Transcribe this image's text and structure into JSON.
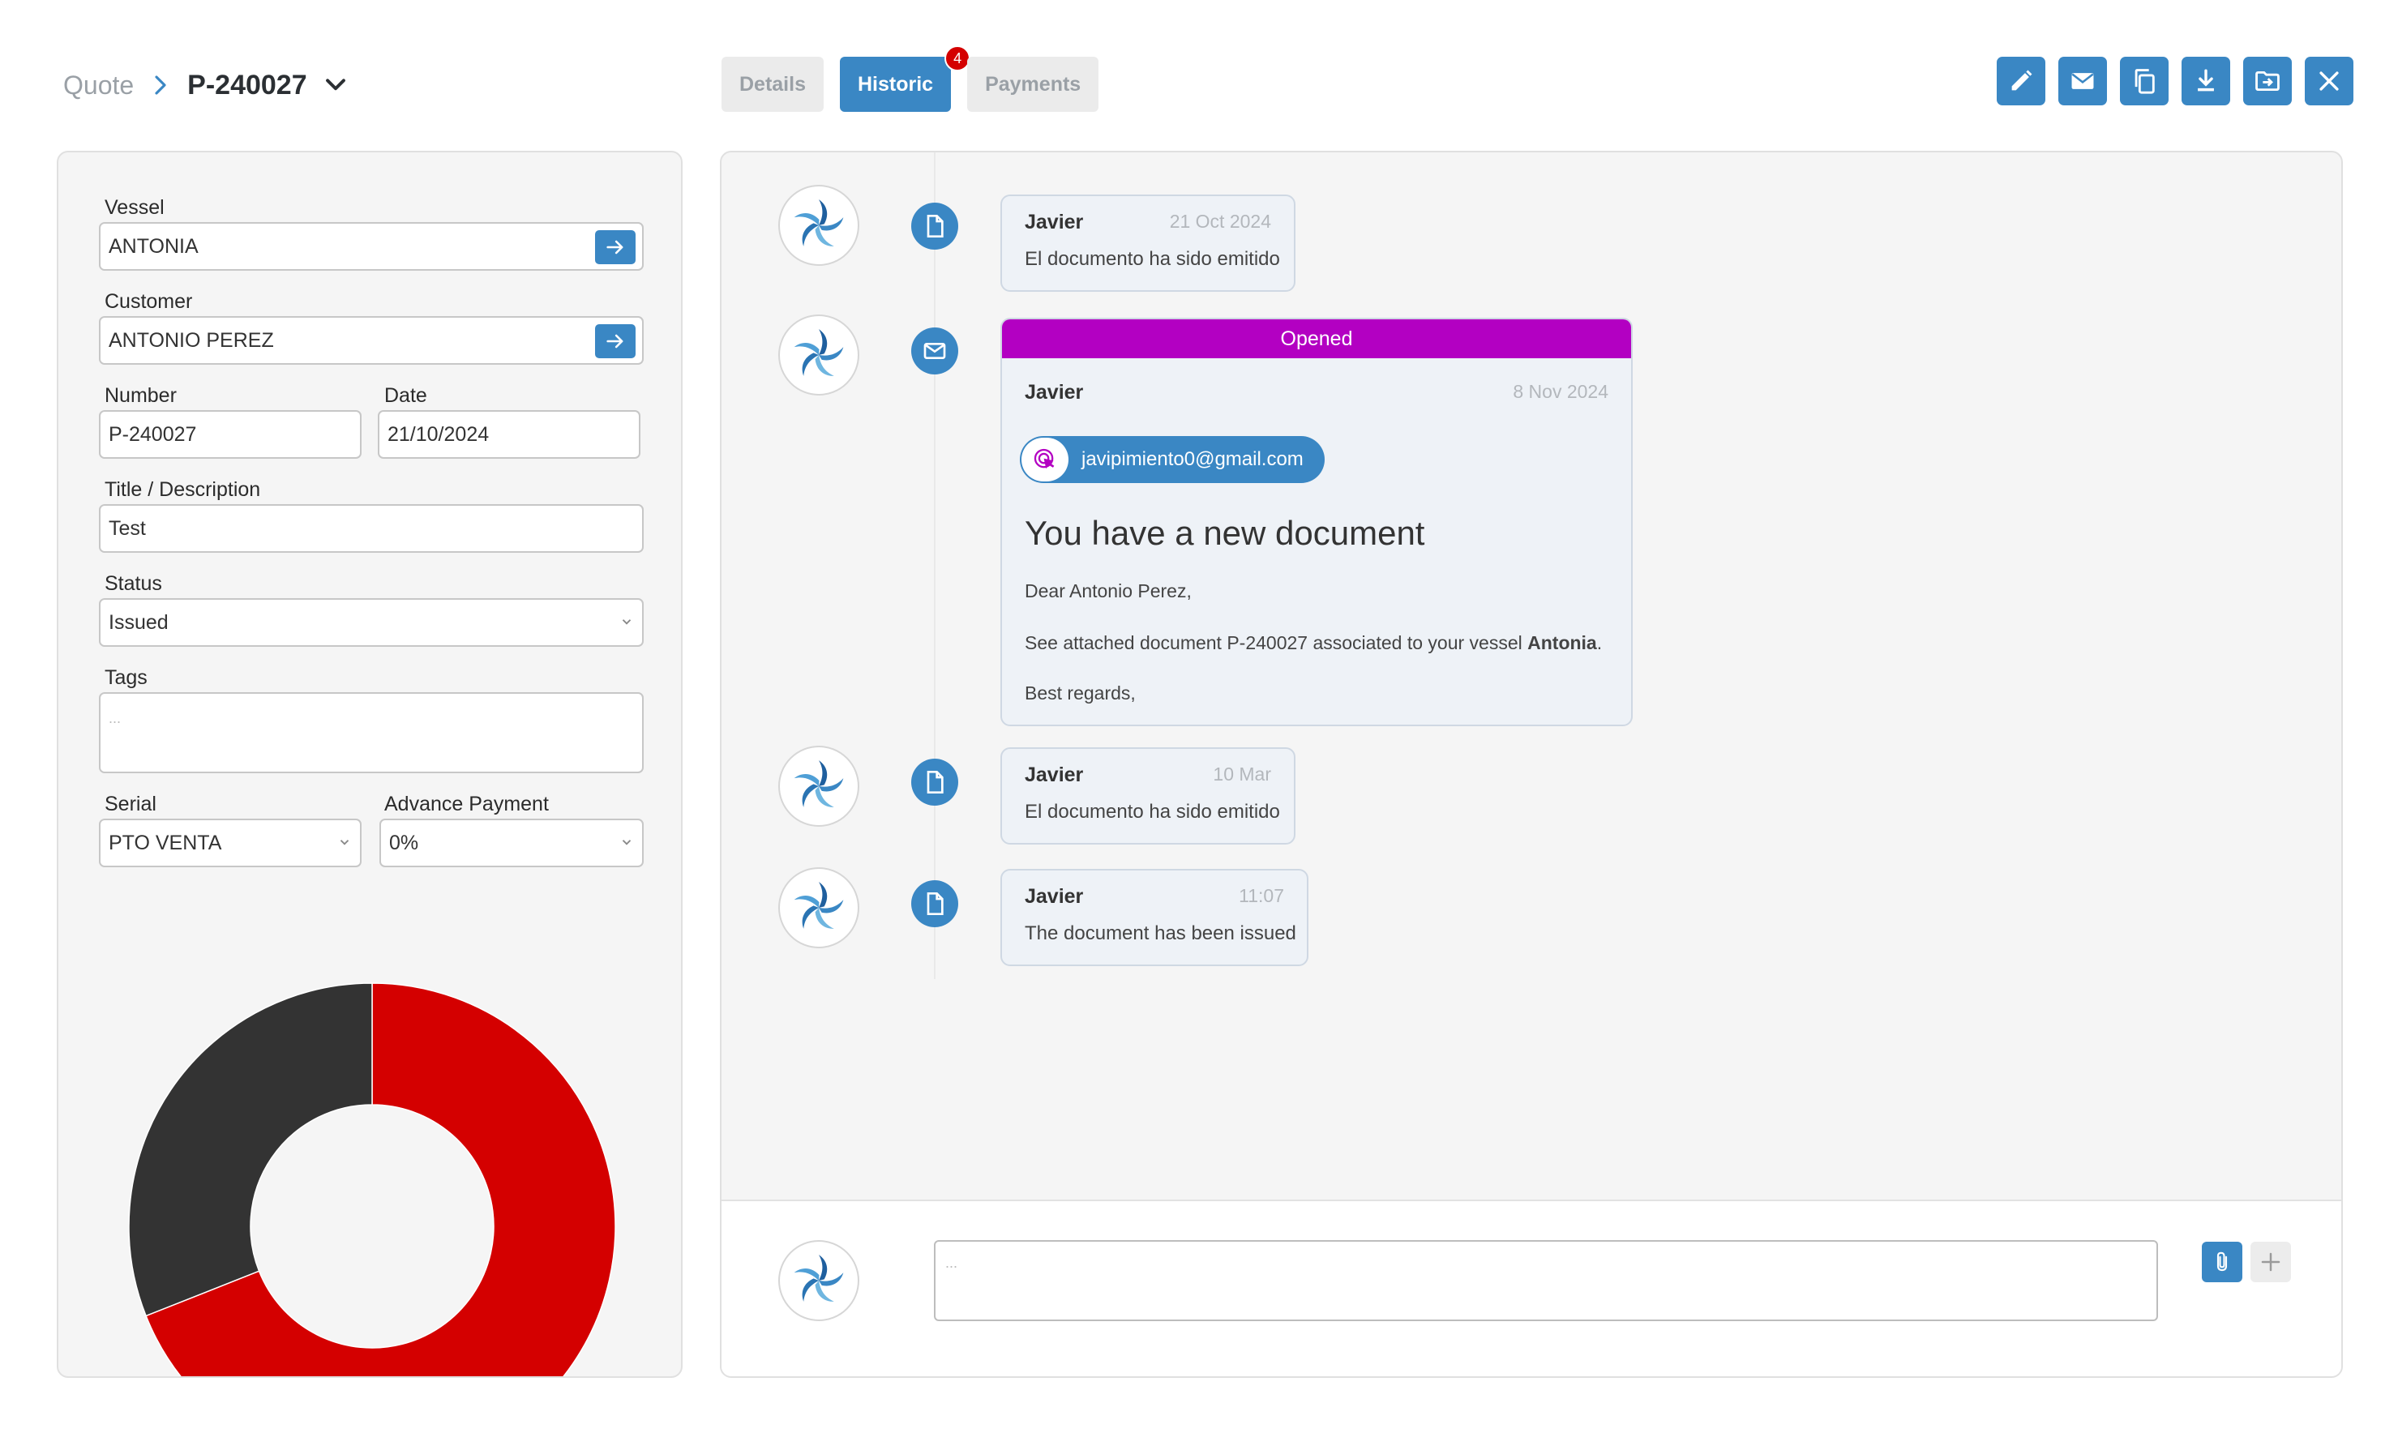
{
  "breadcrumb": {
    "root": "Quote",
    "current": "P-240027"
  },
  "tabs": [
    {
      "label": "Details",
      "active": false
    },
    {
      "label": "Historic",
      "active": true,
      "badge": "4"
    },
    {
      "label": "Payments",
      "active": false
    }
  ],
  "toolbar": {
    "icons": [
      "edit-icon",
      "mail-icon",
      "copy-icon",
      "download-icon",
      "move-folder-icon",
      "close-icon"
    ],
    "color": "#3a87c4"
  },
  "form": {
    "vessel_label": "Vessel",
    "vessel_value": "ANTONIA",
    "customer_label": "Customer",
    "customer_value": "ANTONIO PEREZ",
    "number_label": "Number",
    "number_value": "P-240027",
    "date_label": "Date",
    "date_value": "21/10/2024",
    "title_label": "Title / Description",
    "title_value": "Test",
    "status_label": "Status",
    "status_value": "Issued",
    "tags_label": "Tags",
    "tags_placeholder": "...",
    "serial_label": "Serial",
    "serial_value": "PTO VENTA",
    "advance_label": "Advance Payment",
    "advance_value": "0%"
  },
  "chart_data": {
    "type": "pie",
    "donut": true,
    "values": [
      69,
      31
    ],
    "colors": [
      "#d40000",
      "#333333"
    ]
  },
  "historic": {
    "entries": [
      {
        "type": "document",
        "author": "Javier",
        "time": "21 Oct 2024",
        "text": "El documento ha sido emitido"
      },
      {
        "type": "mail",
        "status": "Opened",
        "author": "Javier",
        "time": "8 Nov 2024",
        "recipient": "javipimiento0@gmail.com",
        "heading": "You have a new document",
        "greeting": "Dear Antonio Perez,",
        "body_prefix": "See attached document P-240027  associated to your vessel ",
        "body_vessel": "Antonia",
        "body_suffix": ".",
        "closing": "Best regards,"
      },
      {
        "type": "document",
        "author": "Javier",
        "time": "10 Mar",
        "text": "El documento ha sido emitido"
      },
      {
        "type": "document",
        "author": "Javier",
        "time": "11:07",
        "text": "The document has been issued"
      }
    ],
    "status_color": "#b300c2"
  },
  "composer": {
    "placeholder": "..."
  }
}
